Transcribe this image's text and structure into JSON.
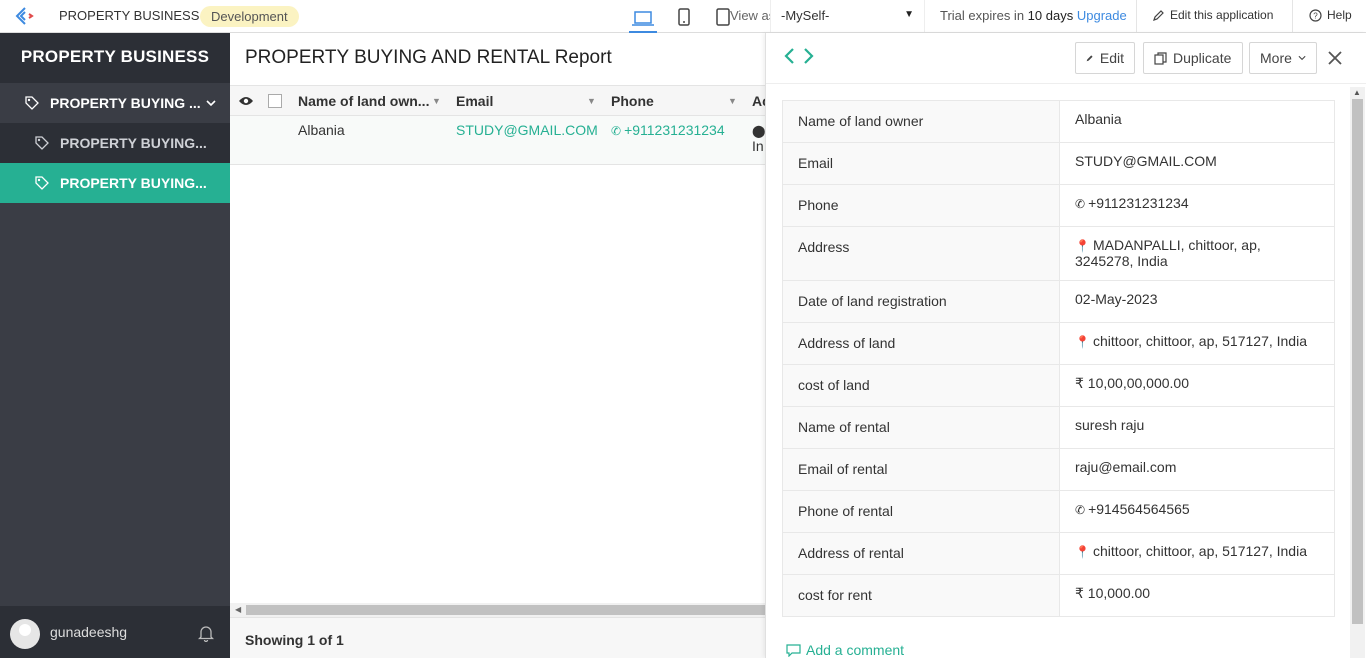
{
  "topbar": {
    "app_name": "PROPERTY BUSINESS",
    "environment": "Development",
    "view_as_label": "View as",
    "view_as_value": "-MySelf-",
    "trial_prefix": "Trial expires in",
    "trial_days": "10 days",
    "upgrade_label": "Upgrade",
    "edit_app_label": "Edit this application",
    "help_label": "Help"
  },
  "sidebar": {
    "brand": "PROPERTY BUSINESS",
    "parent_label": "PROPERTY BUYING ...",
    "items": [
      {
        "label": "PROPERTY BUYING..."
      },
      {
        "label": "PROPERTY BUYING..."
      }
    ],
    "username": "gunadeeshg"
  },
  "report": {
    "title": "PROPERTY BUYING AND RENTAL Report",
    "columns": [
      "Name of land own...",
      "Email",
      "Phone",
      "Ac"
    ],
    "row": {
      "name": "Albania",
      "email": "STUDY@GMAIL.COM",
      "phone": "+911231231234",
      "address_cut": "In"
    },
    "footer": "Showing 1 of 1"
  },
  "detail": {
    "buttons": {
      "edit": "Edit",
      "duplicate": "Duplicate",
      "more": "More"
    },
    "fields": [
      {
        "label": "Name of land owner",
        "value": "Albania"
      },
      {
        "label": "Email",
        "value": "STUDY@GMAIL.COM"
      },
      {
        "label": "Phone",
        "value": "+911231231234"
      },
      {
        "label": "Address",
        "value": "MADANPALLI, chittoor, ap, 3245278, India"
      },
      {
        "label": "Date of land registration",
        "value": "02-May-2023"
      },
      {
        "label": "Address of land",
        "value": "chittoor, chittoor, ap, 517127, India"
      },
      {
        "label": "cost of land",
        "value": "₹ 10,00,00,000.00"
      },
      {
        "label": "Name of rental",
        "value": "suresh raju"
      },
      {
        "label": "Email of rental",
        "value": "raju@email.com"
      },
      {
        "label": "Phone of rental",
        "value": "+914564564565"
      },
      {
        "label": "Address of rental",
        "value": "chittoor, chittoor, ap, 517127, India"
      },
      {
        "label": "cost for rent",
        "value": "₹ 10,000.00"
      }
    ],
    "comment_label": "Add a comment"
  },
  "colors": {
    "accent": "#26b093",
    "sidebar": "#3a3d45",
    "link_blue": "#3d8ae0"
  }
}
